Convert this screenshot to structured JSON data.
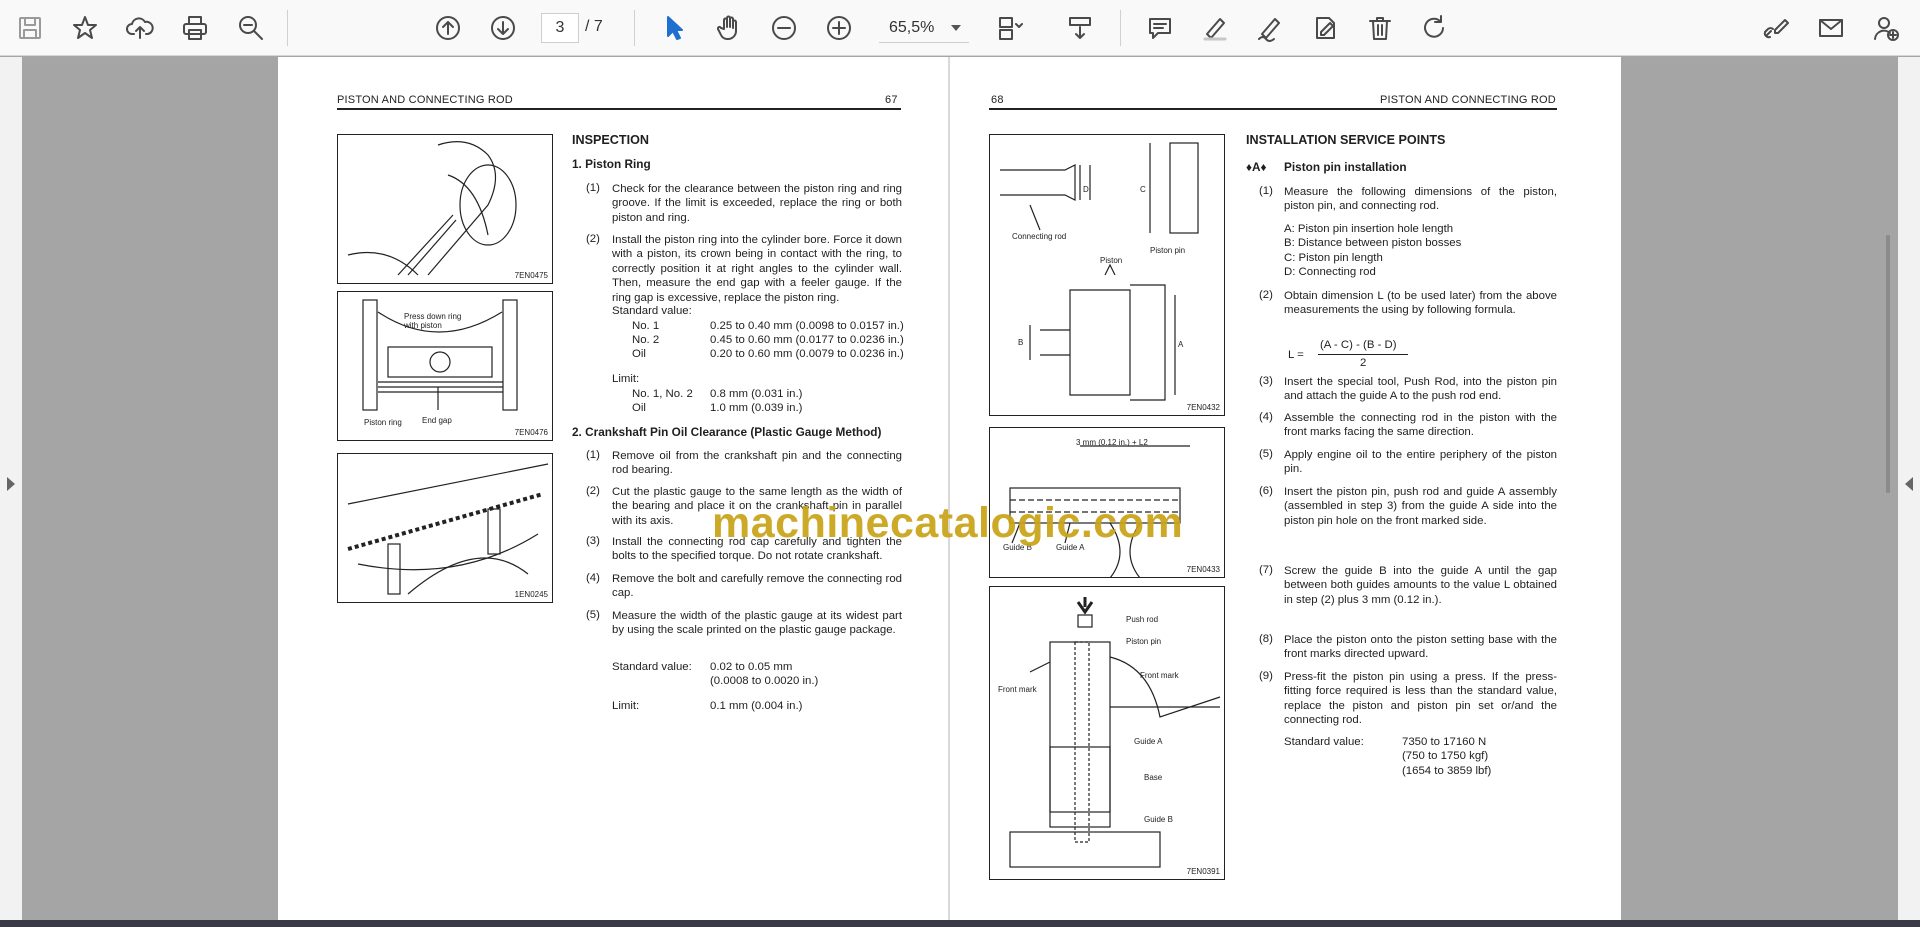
{
  "toolbar": {
    "page_current": "3",
    "page_total": "/ 7",
    "zoom": "65,5%"
  },
  "left_page": {
    "running_title": "PISTON AND CONNECTING ROD",
    "page_number": "67",
    "fig1_code": "7EN0475",
    "fig2_code": "7EN0476",
    "fig2_label_top": "Press down ring\nwith piston",
    "fig2_label_ring": "Piston ring",
    "fig2_label_gap": "End gap",
    "fig3_code": "1EN0245",
    "section_heading": "INSPECTION",
    "sub1_heading": "1. Piston Ring",
    "sub1_items": [
      {
        "n": "(1)",
        "text": "Check for the clearance between the piston ring and ring groove. If the limit is exceeded, replace the ring or both piston and ring."
      },
      {
        "n": "(2)",
        "text": "Install the piston ring into the cylinder bore. Force it down with a piston, its crown being in contact with the ring, to correctly position it at right angles to the cylinder wall. Then, measure the end gap with a feeler gauge. If the ring gap is excessive, replace the piston ring."
      }
    ],
    "std_value_label": "Standard value:",
    "std_rows": [
      {
        "name": "No. 1",
        "value": "0.25 to 0.40 mm (0.0098 to 0.0157 in.)"
      },
      {
        "name": "No. 2",
        "value": "0.45 to 0.60 mm (0.0177 to 0.0236 in.)"
      },
      {
        "name": "Oil",
        "value": "0.20 to 0.60 mm (0.0079 to 0.0236 in.)"
      }
    ],
    "limit_label": "Limit:",
    "limit_rows": [
      {
        "name": "No. 1, No. 2",
        "value": "0.8 mm (0.031 in.)"
      },
      {
        "name": "Oil",
        "value": "1.0 mm (0.039 in.)"
      }
    ],
    "sub2_heading": "2.  Crankshaft Pin Oil Clearance (Plastic Gauge Method)",
    "sub2_items": [
      {
        "n": "(1)",
        "text": "Remove oil from the crankshaft pin and the connecting rod bearing."
      },
      {
        "n": "(2)",
        "text": "Cut the plastic gauge to the same length as the width of the bearing and place it on the crankshaft pin in parallel with its axis."
      },
      {
        "n": "(3)",
        "text": "Install the connecting rod cap carefully and tighten the bolts to the specified torque. Do not rotate crankshaft."
      },
      {
        "n": "(4)",
        "text": "Remove the bolt and carefully remove the connecting rod cap."
      },
      {
        "n": "(5)",
        "text": "Measure the width of the plastic gauge at its widest part by using the scale printed on the plastic gauge package."
      }
    ],
    "sub2_std_label": "Standard value:",
    "sub2_std_value": "0.02 to 0.05 mm\n(0.0008 to 0.0020 in.)",
    "sub2_limit_label": "Limit:",
    "sub2_limit_value": "0.1 mm (0.004 in.)"
  },
  "right_page": {
    "page_number": "68",
    "running_title": "PISTON AND CONNECTING ROD",
    "fig1_code": "7EN0432",
    "fig1_labels": {
      "conrod": "Connecting rod",
      "pin": "Piston pin",
      "piston": "Piston",
      "c": "C",
      "d": "D",
      "a": "A",
      "b": "B"
    },
    "fig2_code": "7EN0433",
    "fig2_labels": {
      "top": "3 mm (0.12 in.) + L2",
      "guide_b": "Guide B",
      "guide_a": "Guide A"
    },
    "fig3_code": "7EN0391",
    "fig3_labels": {
      "push_rod": "Push rod",
      "piston_pin": "Piston pin",
      "front_mark_r": "Front mark",
      "front_mark_l": "Front mark",
      "guide_a": "Guide A",
      "base": "Base",
      "guide_b": "Guide B"
    },
    "section_heading": "INSTALLATION SERVICE POINTS",
    "sub_marker": "♦A♦",
    "sub_heading": "Piston pin installation",
    "item1_n": "(1)",
    "item1_text": "Measure the following dimensions of the piston, piston pin, and connecting rod.",
    "dims": [
      "A:  Piston pin insertion hole length",
      "B:  Distance between piston bosses",
      "C:  Piston pin length",
      "D:  Connecting rod"
    ],
    "item2_n": "(2)",
    "item2_text": "Obtain dimension L (to be used later) from the above measurements the using by following formula.",
    "formula_lhs": "L =",
    "formula_num": "(A - C) - (B - D)",
    "formula_den": "2",
    "items_rest": [
      {
        "n": "(3)",
        "text": "Insert the special tool, Push Rod, into the piston pin and attach the guide A to the push rod end."
      },
      {
        "n": "(4)",
        "text": "Assemble the connecting rod in the piston with the front marks facing the same direction."
      },
      {
        "n": "(5)",
        "text": "Apply engine oil to the entire periphery of the piston pin."
      },
      {
        "n": "(6)",
        "text": "Insert the piston pin, push rod and guide A assembly (assembled in step 3) from the guide A side into the piston pin hole on the front marked side."
      },
      {
        "n": "(7)",
        "text": "Screw the guide B into the guide A until the gap between both guides amounts to the value L obtained in step (2) plus 3 mm (0.12 in.)."
      },
      {
        "n": "(8)",
        "text": "Place the piston onto the piston setting base with the front marks directed upward."
      },
      {
        "n": "(9)",
        "text": "Press-fit the piston pin using a press. If the press-fitting force required is less than the standard value, replace the piston and piston pin set or/and the connecting rod."
      }
    ],
    "std_label": "Standard value:",
    "std_value": "7350 to 17160 N\n(750 to 1750 kgf)\n(1654 to 3859 lbf)"
  },
  "watermark": "machinecatalogic.com"
}
